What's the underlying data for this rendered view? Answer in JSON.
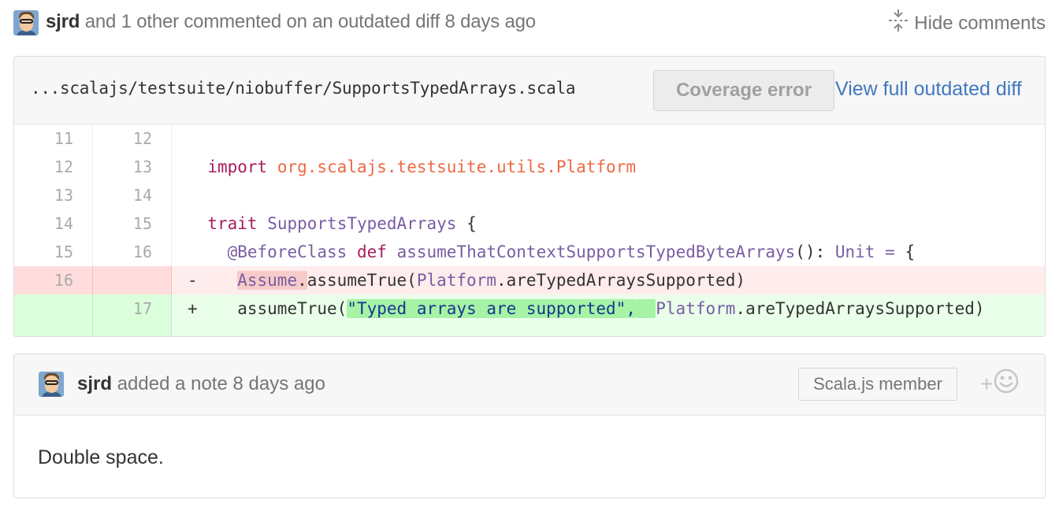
{
  "header": {
    "author": "sjrd",
    "summary": "and 1 other commented on an outdated diff 8 days ago",
    "hide_label": "Hide comments",
    "hide_icon": "fold-icon"
  },
  "diff": {
    "file_path": "...scalajs/testsuite/niobuffer/SupportsTypedArrays.scala",
    "coverage_label": "Coverage error",
    "view_label": "View full outdated diff",
    "lines": [
      {
        "old": "11",
        "new": "12",
        "sign": " ",
        "type": "context"
      },
      {
        "old": "12",
        "new": "13",
        "sign": " ",
        "type": "context"
      },
      {
        "old": "13",
        "new": "14",
        "sign": " ",
        "type": "context"
      },
      {
        "old": "14",
        "new": "15",
        "sign": " ",
        "type": "context"
      },
      {
        "old": "15",
        "new": "16",
        "sign": " ",
        "type": "context"
      },
      {
        "old": "16",
        "new": "",
        "sign": "-",
        "type": "deletion"
      },
      {
        "old": "",
        "new": "17",
        "sign": "+",
        "type": "addition"
      }
    ],
    "tokens": {
      "import_kw": "import",
      "import_pkg": "org.scalajs.testsuite.utils.Platform",
      "trait_kw": "trait",
      "trait_name": "SupportsTypedArrays",
      "brace_open": "{",
      "annotation": "@BeforeClass",
      "def_kw": "def",
      "method_name": "assumeThatContextSupportsTypedByteArrays",
      "parens": "():",
      "unit_type": "Unit",
      "equals": "=",
      "del_assume": "Assume",
      "del_dot": ".",
      "del_call": "assumeTrue(",
      "del_platform": "Platform",
      "del_rest": ".areTypedArraysSupported)",
      "add_call": "assumeTrue(",
      "add_string": "\"Typed arrays are supported\",",
      "add_platform": "Platform",
      "add_rest": ".areTypedArraysSupported)"
    }
  },
  "comment": {
    "author": "sjrd",
    "summary": "added a note 8 days ago",
    "badge": "Scala.js member",
    "reaction_plus": "+",
    "reaction_icon": "smiley-icon",
    "body": "Double space."
  },
  "colors": {
    "link": "#4078c0",
    "deletion_bg": "#ffecec",
    "addition_bg": "#eaffea",
    "keyword": "#a71d5d",
    "package": "#ed6a43",
    "type": "#795da3"
  }
}
